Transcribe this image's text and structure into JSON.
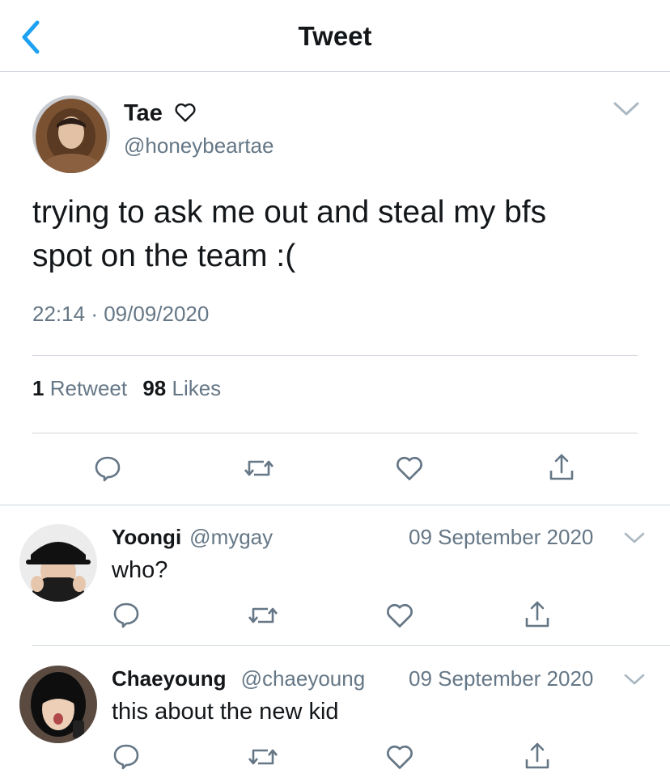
{
  "nav": {
    "title": "Tweet",
    "back_icon": "chevron-left-icon"
  },
  "tweet": {
    "author_name": "Tae",
    "author_heart_icon": "heart-outline-icon",
    "handle": "@honeybeartae",
    "text_line1": "trying to ask me out and steal my bfs",
    "text_line2": "spot on the team :(",
    "time": "22:14",
    "separator": "·",
    "date": "09/09/2020",
    "retweet_count": "1",
    "retweet_label": "Retweet",
    "like_count": "98",
    "like_label": "Likes"
  },
  "replies": [
    {
      "name": "Yoongi",
      "handle": "@mygay",
      "date": "09 September 2020",
      "text": "who?"
    },
    {
      "name": "Chaeyoung",
      "handle": "@chaeyoung",
      "date": "09 September 2020",
      "text": "this about the new kid"
    }
  ],
  "colors": {
    "accent": "#1da1f2",
    "text": "#14171a",
    "secondary": "#657786",
    "divider": "#cfd6dc"
  }
}
